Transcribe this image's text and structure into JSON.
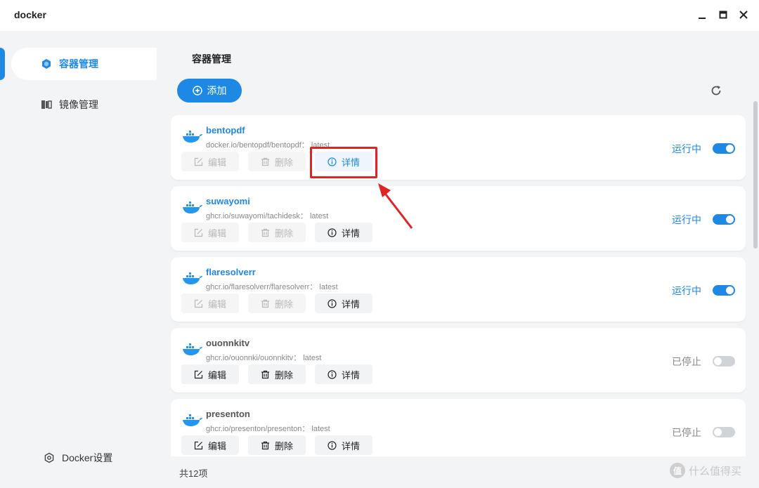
{
  "window": {
    "title": "docker"
  },
  "sidebar": {
    "items": [
      {
        "label": "容器管理",
        "icon": "hexagon-icon",
        "active": true
      },
      {
        "label": "镜像管理",
        "icon": "image-stack-icon",
        "active": false
      }
    ],
    "settings_label": "Docker设置"
  },
  "main": {
    "page_title": "容器管理",
    "add_label": "添加",
    "footer_count": "共12项"
  },
  "buttons": {
    "edit_label": "编辑",
    "delete_label": "删除",
    "detail_label": "详情"
  },
  "containers": [
    {
      "name": "bentopdf",
      "image": "docker.io/bentopdf/bentopdf： latest",
      "status": "运行中",
      "running": true
    },
    {
      "name": "suwayomi",
      "image": "ghcr.io/suwayomi/tachidesk： latest",
      "status": "运行中",
      "running": true
    },
    {
      "name": "flaresolverr",
      "image": "ghcr.io/flaresolverr/flaresolverr： latest",
      "status": "运行中",
      "running": true
    },
    {
      "name": "ouonnkitv",
      "image": "ghcr.io/ouonnki/ouonnkitv： latest",
      "status": "已停止",
      "running": false
    },
    {
      "name": "presenton",
      "image": "ghcr.io/presenton/presenton： latest",
      "status": "已停止",
      "running": false
    }
  ],
  "watermark": {
    "badge": "值",
    "text": "什么值得买"
  },
  "colors": {
    "accent": "#1e88e5",
    "highlight": "#e02424"
  }
}
